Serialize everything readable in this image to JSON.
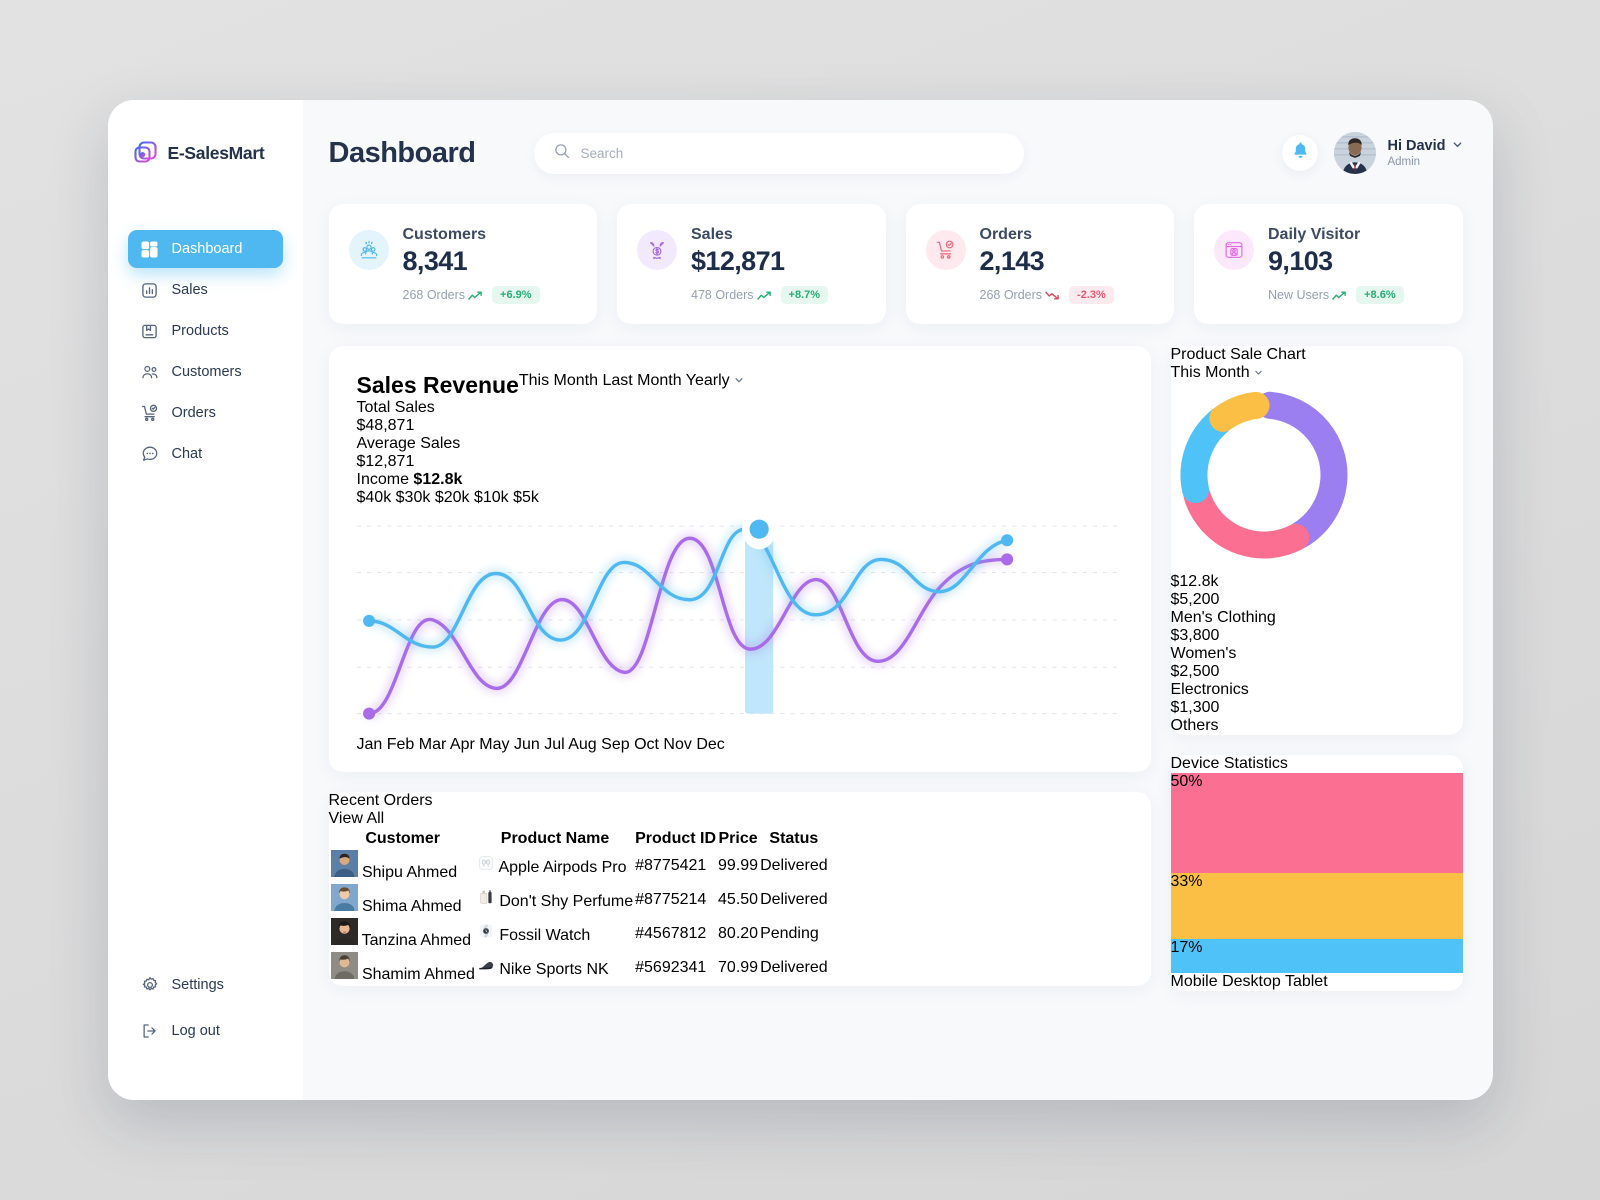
{
  "brand": {
    "name": "E-SalesMart",
    "logo_icon": "layers-logo-icon"
  },
  "sidebar": {
    "items": [
      {
        "label": "Dashboard",
        "icon": "grid-icon",
        "active": true
      },
      {
        "label": "Sales",
        "icon": "bar-chart-icon",
        "active": false
      },
      {
        "label": "Products",
        "icon": "box-icon",
        "active": false
      },
      {
        "label": "Customers",
        "icon": "users-icon",
        "active": false
      },
      {
        "label": "Orders",
        "icon": "cart-check-icon",
        "active": false
      },
      {
        "label": "Chat",
        "icon": "chat-bubble-icon",
        "active": false
      }
    ],
    "bottom": [
      {
        "label": "Settings",
        "icon": "gear-icon"
      },
      {
        "label": "Log out",
        "icon": "logout-icon"
      }
    ]
  },
  "header": {
    "title": "Dashboard",
    "search": {
      "placeholder": "Search",
      "value": "",
      "icon": "search-icon"
    },
    "notification_icon": "bell-icon",
    "user": {
      "greeting": "Hi David",
      "role": "Admin",
      "chevron": "chevron-down-icon"
    }
  },
  "stats": [
    {
      "label": "Customers",
      "value": "8,341",
      "sub": "268 Orders",
      "trend": "up",
      "delta": "+6.9%",
      "icon": "customers-group-icon",
      "icon_bg": "#e3f4fd",
      "icon_color": "#4fb8f0"
    },
    {
      "label": "Sales",
      "value": "$12,871",
      "sub": "478 Orders",
      "trend": "up",
      "delta": "+8.7%",
      "icon": "sales-tag-icon",
      "icon_bg": "#f3e9fd",
      "icon_color": "#a66ce0"
    },
    {
      "label": "Orders",
      "value": "2,143",
      "sub": "268 Orders",
      "trend": "down",
      "delta": "-2.3%",
      "icon": "order-cart-icon",
      "icon_bg": "#fde9ee",
      "icon_color": "#f2647c"
    },
    {
      "label": "Daily Visitor",
      "value": "9,103",
      "sub": "New Users",
      "trend": "up",
      "delta": "+8.6%",
      "icon": "visitor-card-icon",
      "icon_bg": "#fbe8fb",
      "icon_color": "#e468e4"
    }
  ],
  "sales_revenue": {
    "title": "Sales Revenue",
    "legend": [
      {
        "label": "This Month",
        "color": "#4fb8f0"
      },
      {
        "label": "Last Month",
        "color": "#a96ce8"
      }
    ],
    "range_selector": "Yearly",
    "kpis": [
      {
        "label": "Total Sales",
        "value": "$48,871"
      },
      {
        "label": "Average Sales",
        "value": "$12,871"
      }
    ],
    "tooltip": {
      "label": "Income",
      "value": "$12.8k",
      "month": "Jul"
    }
  },
  "recent_orders": {
    "title": "Recent Orders",
    "view_all": "View All",
    "columns": [
      "Customer",
      "Product Name",
      "Product ID",
      "Price",
      "Status"
    ],
    "rows": [
      {
        "customer": "Shipu Ahmed",
        "product": "Apple Airpods Pro",
        "product_icon": "earbuds-icon",
        "id": "#8775421",
        "price": "99.99",
        "status": "Delivered"
      },
      {
        "customer": "Shima Ahmed",
        "product": "Don't Shy Perfume",
        "product_icon": "perfume-icon",
        "id": "#8775214",
        "price": "45.50",
        "status": "Delivered"
      },
      {
        "customer": "Tanzina Ahmed",
        "product": "Fossil Watch",
        "product_icon": "watch-icon",
        "id": "#4567812",
        "price": "80.20",
        "status": "Pending"
      },
      {
        "customer": "Shamim Ahmed",
        "product": "Nike Sports NK",
        "product_icon": "shoe-icon",
        "id": "#5692341",
        "price": "70.99",
        "status": "Delivered"
      }
    ]
  },
  "product_sale": {
    "title": "Product Sale Chart",
    "selector": "This Month",
    "center_value": "$12.8k",
    "legend": [
      {
        "value": "$5,200",
        "label": "Men's Clothing",
        "color": "#9b7ef0"
      },
      {
        "value": "$3,800",
        "label": "Women's",
        "color": "#fb6f92"
      },
      {
        "value": "$2,500",
        "label": "Electronics",
        "color": "#4fc3f7"
      },
      {
        "value": "$1,300",
        "label": "Others",
        "color": "#fbbf45"
      }
    ]
  },
  "device_statistics": {
    "title": "Device Statistics"
  },
  "chart_data": [
    {
      "type": "line",
      "title": "Sales Revenue",
      "xlabel": "",
      "ylabel": "",
      "categories": [
        "Jan",
        "Feb",
        "Mar",
        "Apr",
        "May",
        "Jun",
        "Jul",
        "Aug",
        "Sep",
        "Oct",
        "Nov",
        "Dec"
      ],
      "ylim": [
        0,
        42000
      ],
      "yticks": [
        5000,
        10000,
        20000,
        30000,
        40000
      ],
      "ytick_labels": [
        "$5k",
        "$10k",
        "$20k",
        "$30k",
        "$40k"
      ],
      "grid": true,
      "legend_position": "top-right",
      "series": [
        {
          "name": "This Month",
          "color": "#4fb8f0",
          "values": [
            19500,
            14500,
            26500,
            17500,
            29500,
            23500,
            38500,
            21500,
            31500,
            27500,
            31000,
            39500
          ]
        },
        {
          "name": "Last Month",
          "color": "#a96ce8",
          "values": [
            5000,
            19500,
            7500,
            23000,
            12500,
            10300,
            38000,
            16000,
            27000,
            14500,
            20000,
            28500
          ]
        }
      ],
      "highlight": {
        "x": "Jul",
        "label": "Income",
        "value": "$12.8k"
      }
    },
    {
      "type": "pie",
      "title": "Product Sale Chart",
      "center_label": "$12.8k",
      "labels": [
        "Men's Clothing",
        "Women's",
        "Electronics",
        "Others"
      ],
      "values": [
        5200,
        3800,
        2500,
        1300
      ],
      "colors": [
        "#9b7ef0",
        "#fb6f92",
        "#4fc3f7",
        "#fbbf45"
      ],
      "legend_position": "bottom"
    },
    {
      "type": "bar",
      "title": "Device Statistics",
      "categories": [
        "Mobile",
        "Desktop",
        "Tablet"
      ],
      "values": [
        50,
        33,
        17
      ],
      "value_labels": [
        "50%",
        "33%",
        "17%"
      ],
      "colors": [
        "#fb6f92",
        "#fbbf45",
        "#4fc3f7"
      ],
      "ylim": [
        0,
        55
      ],
      "grid": false,
      "legend_position": "bottom"
    }
  ]
}
